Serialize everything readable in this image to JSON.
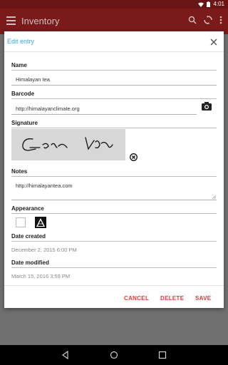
{
  "status_bar": {
    "time": "4:01"
  },
  "app_bar": {
    "title": "Inventory"
  },
  "dialog": {
    "title": "Edit entry",
    "fields": {
      "name_label": "Name",
      "name_value": "Himalayan tea",
      "barcode_label": "Barcode",
      "barcode_value": "http://himalayanclimate.org",
      "signature_label": "Signature",
      "notes_label": "Notes",
      "notes_value": "http://himalayantea.com",
      "appearance_label": "Appearance",
      "date_created_label": "Date created",
      "date_created_value": "December 2, 2015 6:00 PM",
      "date_modified_label": "Date modified",
      "date_modified_value": "March 15, 2016 3:59 PM"
    },
    "buttons": {
      "cancel": "CANCEL",
      "delete": "DELETE",
      "save": "SAVE"
    }
  },
  "colors": {
    "accent": "#3aa6d8",
    "primary": "#7a1a1a",
    "button_text": "#e53935"
  },
  "icons": [
    "menu-icon",
    "search-icon",
    "sync-icon",
    "more-vert-icon",
    "close-icon",
    "camera-icon",
    "clear-signature-icon",
    "texture-icon",
    "back-icon",
    "home-icon",
    "recents-icon"
  ]
}
